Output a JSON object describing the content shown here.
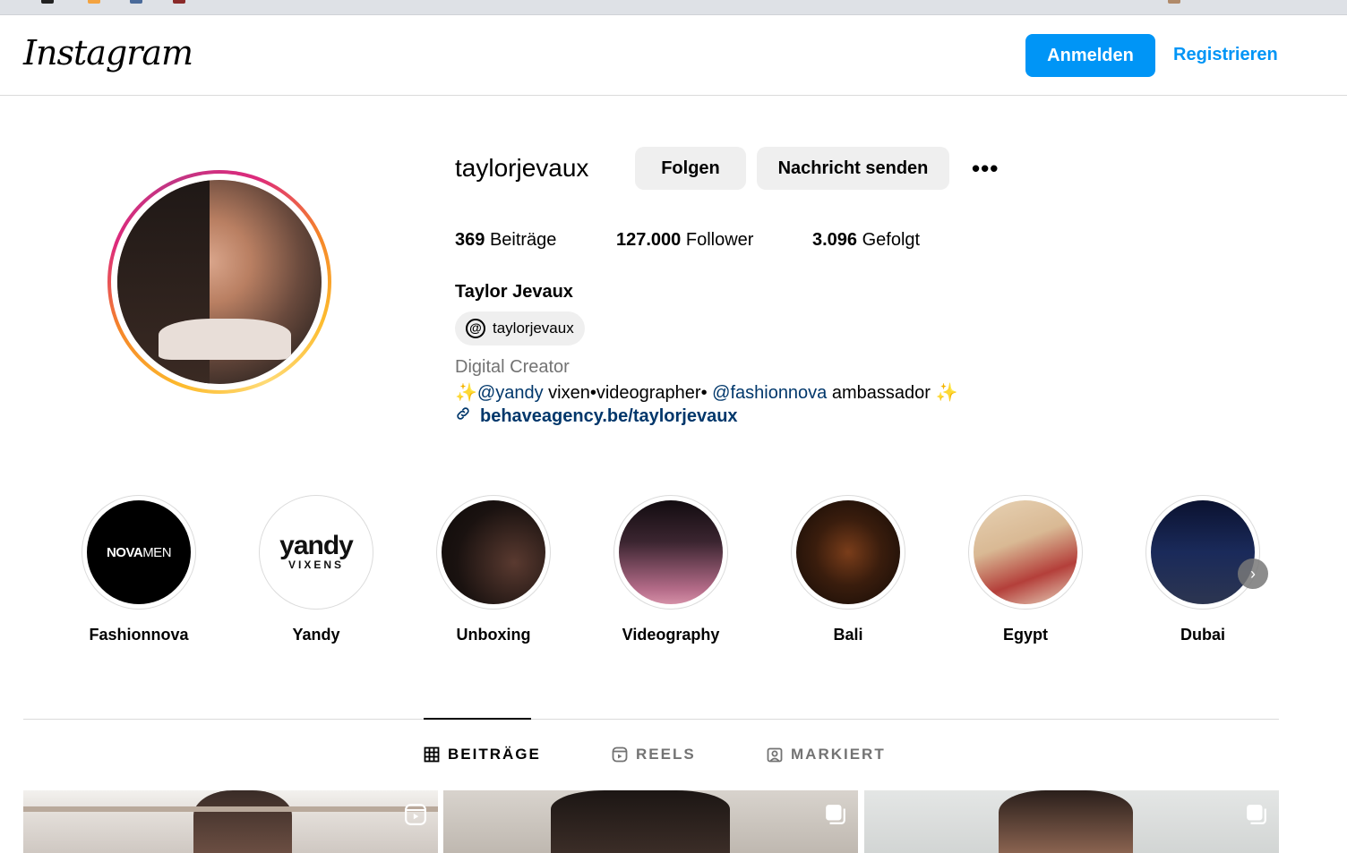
{
  "brand": {
    "logo": "Instagram"
  },
  "header": {
    "login_label": "Anmelden",
    "register_label": "Registrieren"
  },
  "profile": {
    "username": "taylorjevaux",
    "follow_label": "Folgen",
    "message_label": "Nachricht senden",
    "stats": {
      "posts_count": "369",
      "posts_label": "Beiträge",
      "followers_count": "127.000",
      "followers_label": "Follower",
      "following_count": "3.096",
      "following_label": "Gefolgt"
    },
    "full_name": "Taylor Jevaux",
    "threads_handle": "taylorjevaux",
    "category": "Digital Creator",
    "bio": {
      "spark": "✨",
      "mention1": "@yandy",
      "text1": " vixen•videographer• ",
      "mention2": "@fashionnova",
      "text2": " ambassador "
    },
    "link": "behaveagency.be/taylorjevaux"
  },
  "highlights": [
    {
      "label": "Fashionnova",
      "cover_text_bold": "NOVA",
      "cover_text_thin": "MEN"
    },
    {
      "label": "Yandy",
      "cover_text_big": "yandy",
      "cover_text_small": "VIXENS"
    },
    {
      "label": "Unboxing"
    },
    {
      "label": "Videography"
    },
    {
      "label": "Bali"
    },
    {
      "label": "Egypt"
    },
    {
      "label": "Dubai"
    }
  ],
  "tabs": [
    {
      "label": "BEITRÄGE",
      "active": true
    },
    {
      "label": "REELS",
      "active": false
    },
    {
      "label": "MARKIERT",
      "active": false
    }
  ],
  "colors": {
    "primary": "#0095f6",
    "link": "#00376b",
    "muted": "#737373",
    "button_gray": "#efefef"
  }
}
